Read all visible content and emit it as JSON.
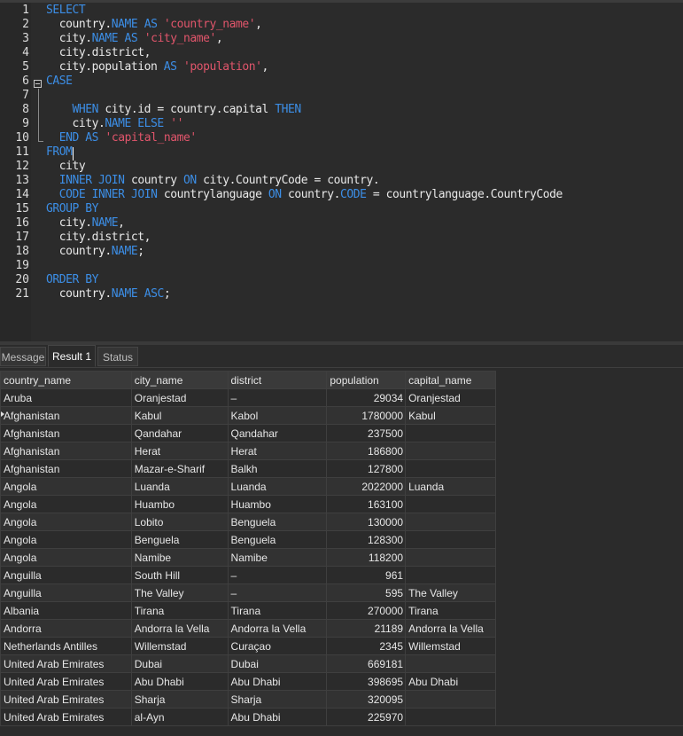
{
  "editor": {
    "lines": [
      {
        "num": "1",
        "parts": [
          [
            "kw",
            "SELECT"
          ]
        ]
      },
      {
        "num": "2",
        "parts": [
          [
            "t",
            "  country."
          ],
          [
            "kw",
            "NAME"
          ],
          [
            "t",
            " "
          ],
          [
            "kw",
            "AS"
          ],
          [
            "t",
            " "
          ],
          [
            "str",
            "'country_name'"
          ],
          [
            "t",
            ","
          ]
        ]
      },
      {
        "num": "3",
        "parts": [
          [
            "t",
            "  city."
          ],
          [
            "kw",
            "NAME"
          ],
          [
            "t",
            " "
          ],
          [
            "kw",
            "AS"
          ],
          [
            "t",
            " "
          ],
          [
            "str",
            "'city_name'"
          ],
          [
            "t",
            ","
          ]
        ]
      },
      {
        "num": "4",
        "parts": [
          [
            "t",
            "  city.district,"
          ]
        ]
      },
      {
        "num": "5",
        "parts": [
          [
            "t",
            "  city.population "
          ],
          [
            "kw",
            "AS"
          ],
          [
            "t",
            " "
          ],
          [
            "str",
            "'population'"
          ],
          [
            "t",
            ","
          ]
        ]
      },
      {
        "num": "6",
        "parts": [
          [
            "kw",
            "CASE"
          ]
        ]
      },
      {
        "num": "7",
        "parts": []
      },
      {
        "num": "8",
        "parts": [
          [
            "t",
            "    "
          ],
          [
            "kw",
            "WHEN"
          ],
          [
            "t",
            " city.id = country.capital "
          ],
          [
            "kw",
            "THEN"
          ]
        ]
      },
      {
        "num": "9",
        "parts": [
          [
            "t",
            "    city."
          ],
          [
            "kw",
            "NAME"
          ],
          [
            "t",
            " "
          ],
          [
            "kw",
            "ELSE"
          ],
          [
            "t",
            " "
          ],
          [
            "str",
            "''"
          ]
        ]
      },
      {
        "num": "10",
        "parts": [
          [
            "t",
            "  "
          ],
          [
            "kw",
            "END"
          ],
          [
            "t",
            " "
          ],
          [
            "kw",
            "AS"
          ],
          [
            "t",
            " "
          ],
          [
            "str",
            "'capital_name'"
          ]
        ]
      },
      {
        "num": "11",
        "parts": [
          [
            "kw",
            "FROM"
          ]
        ]
      },
      {
        "num": "12",
        "parts": [
          [
            "t",
            "  city"
          ]
        ]
      },
      {
        "num": "13",
        "parts": [
          [
            "t",
            "  "
          ],
          [
            "kw",
            "INNER"
          ],
          [
            "t",
            " "
          ],
          [
            "kw",
            "JOIN"
          ],
          [
            "t",
            " country "
          ],
          [
            "kw",
            "ON"
          ],
          [
            "t",
            " city.CountryCode = country."
          ]
        ]
      },
      {
        "num": "14",
        "parts": [
          [
            "t",
            "  "
          ],
          [
            "kw",
            "CODE"
          ],
          [
            "t",
            " "
          ],
          [
            "kw",
            "INNER"
          ],
          [
            "t",
            " "
          ],
          [
            "kw",
            "JOIN"
          ],
          [
            "t",
            " countrylanguage "
          ],
          [
            "kw",
            "ON"
          ],
          [
            "t",
            " country."
          ],
          [
            "kw",
            "CODE"
          ],
          [
            "t",
            " = countrylanguage.CountryCode"
          ]
        ]
      },
      {
        "num": "15",
        "parts": [
          [
            "kw",
            "GROUP BY"
          ]
        ]
      },
      {
        "num": "16",
        "parts": [
          [
            "t",
            "  city."
          ],
          [
            "kw",
            "NAME"
          ],
          [
            "t",
            ","
          ]
        ]
      },
      {
        "num": "17",
        "parts": [
          [
            "t",
            "  city.district,"
          ]
        ]
      },
      {
        "num": "18",
        "parts": [
          [
            "t",
            "  country."
          ],
          [
            "kw",
            "NAME"
          ],
          [
            "t",
            ";"
          ]
        ]
      },
      {
        "num": "19",
        "parts": []
      },
      {
        "num": "20",
        "parts": [
          [
            "kw",
            "ORDER BY"
          ]
        ]
      },
      {
        "num": "21",
        "parts": [
          [
            "t",
            "  country."
          ],
          [
            "kw",
            "NAME"
          ],
          [
            "t",
            " "
          ],
          [
            "kw",
            "ASC"
          ],
          [
            "t",
            ";"
          ]
        ]
      }
    ]
  },
  "tabs": [
    {
      "label": "Message"
    },
    {
      "label": "Result 1"
    },
    {
      "label": "Status"
    }
  ],
  "results": {
    "columns": [
      "country_name",
      "city_name",
      "district",
      "population",
      "capital_name"
    ],
    "rows": [
      [
        "Aruba",
        "Oranjestad",
        "–",
        "29034",
        "Oranjestad"
      ],
      [
        "Afghanistan",
        "Kabul",
        "Kabol",
        "1780000",
        "Kabul"
      ],
      [
        "Afghanistan",
        "Qandahar",
        "Qandahar",
        "237500",
        ""
      ],
      [
        "Afghanistan",
        "Herat",
        "Herat",
        "186800",
        ""
      ],
      [
        "Afghanistan",
        "Mazar-e-Sharif",
        "Balkh",
        "127800",
        ""
      ],
      [
        "Angola",
        "Luanda",
        "Luanda",
        "2022000",
        "Luanda"
      ],
      [
        "Angola",
        "Huambo",
        "Huambo",
        "163100",
        ""
      ],
      [
        "Angola",
        "Lobito",
        "Benguela",
        "130000",
        ""
      ],
      [
        "Angola",
        "Benguela",
        "Benguela",
        "128300",
        ""
      ],
      [
        "Angola",
        "Namibe",
        "Namibe",
        "118200",
        ""
      ],
      [
        "Anguilla",
        "South Hill",
        "–",
        "961",
        ""
      ],
      [
        "Anguilla",
        "The Valley",
        "–",
        "595",
        "The Valley"
      ],
      [
        "Albania",
        "Tirana",
        "Tirana",
        "270000",
        "Tirana"
      ],
      [
        "Andorra",
        "Andorra la Vella",
        "Andorra la Vella",
        "21189",
        "Andorra la Vella"
      ],
      [
        "Netherlands Antilles",
        "Willemstad",
        "Curaçao",
        "2345",
        "Willemstad"
      ],
      [
        "United Arab Emirates",
        "Dubai",
        "Dubai",
        "669181",
        ""
      ],
      [
        "United Arab Emirates",
        "Abu Dhabi",
        "Abu Dhabi",
        "398695",
        "Abu Dhabi"
      ],
      [
        "United Arab Emirates",
        "Sharja",
        "Sharja",
        "320095",
        ""
      ],
      [
        "United Arab Emirates",
        "al-Ayn",
        "Abu Dhabi",
        "225970",
        ""
      ]
    ]
  },
  "colors": {
    "keyword": "#3c8ee6",
    "string": "#e0556b",
    "text": "#e8e8e8",
    "background": "#2b2b2b"
  }
}
